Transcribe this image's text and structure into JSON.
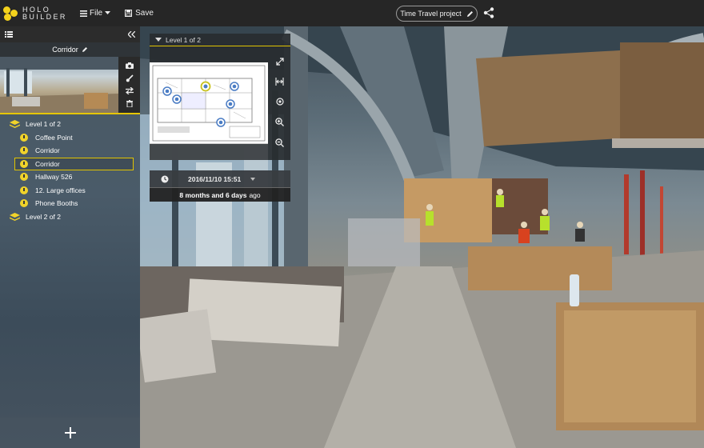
{
  "app": {
    "logo_line1": "HOLO",
    "logo_line2": "BUILDER"
  },
  "toolbar": {
    "file_label": "File",
    "save_label": "Save",
    "project_label": "Time Travel project"
  },
  "sidebar": {
    "current_photo_title": "Corridor",
    "tree": [
      {
        "type": "level",
        "label": "Level 1 of 2"
      },
      {
        "type": "photo",
        "label": "Coffee Point"
      },
      {
        "type": "photo",
        "label": "Corridor"
      },
      {
        "type": "photo",
        "label": "Corridor",
        "selected": true
      },
      {
        "type": "photo",
        "label": "Hallway 526"
      },
      {
        "type": "photo",
        "label": "12. Large offices"
      },
      {
        "type": "photo",
        "label": "Phone Booths"
      },
      {
        "type": "level",
        "label": "Level 2 of 2"
      }
    ]
  },
  "map_panel": {
    "level_label": "Level 1 of 2"
  },
  "time_panel": {
    "date": "2016/11/10 15:51",
    "ago_bold": "8 months and 6 days",
    "ago_suffix": "ago"
  },
  "colors": {
    "accent": "#e1c300",
    "topbar": "#262626",
    "pin": "#f1d32a"
  }
}
